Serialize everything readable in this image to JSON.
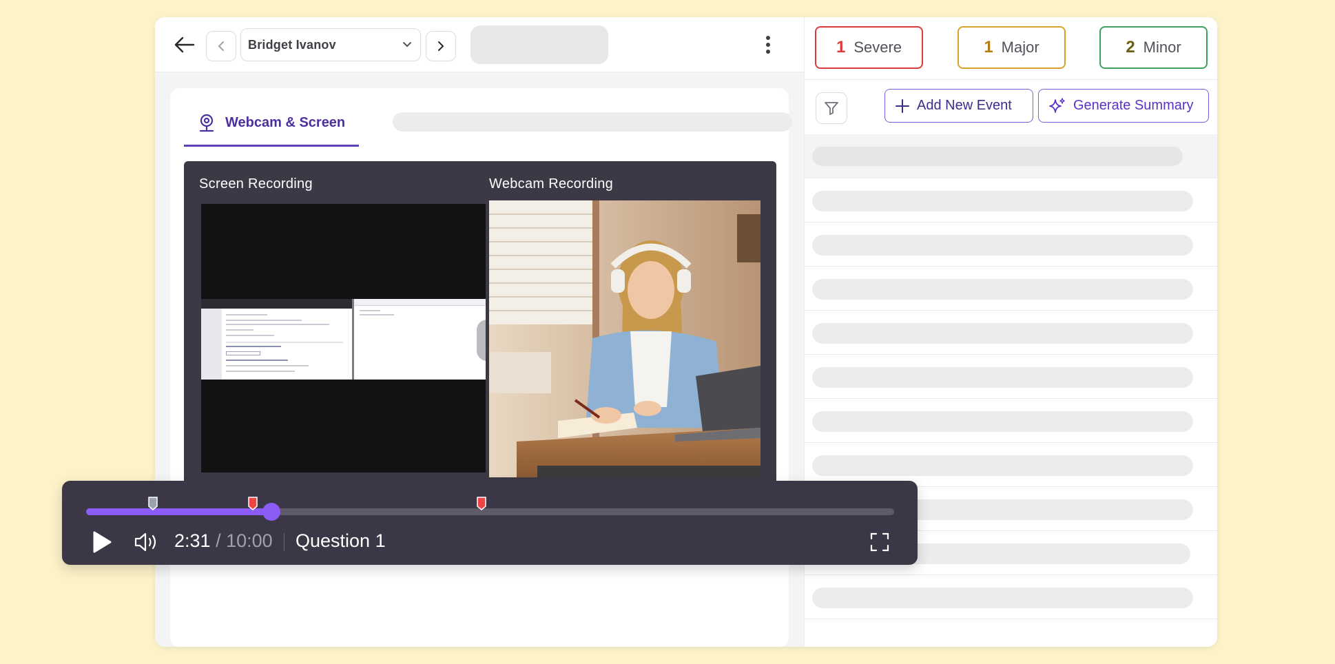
{
  "header": {
    "candidate_name": "Bridget  Ivanov",
    "back_icon": "arrow-left-icon",
    "prev_icon": "chevron-left-icon",
    "next_icon": "chevron-right-icon",
    "dropdown_icon": "chevron-down-icon",
    "menu_icon": "kebab-menu-icon"
  },
  "tabs": [
    {
      "label": "Webcam & Screen",
      "icon": "webcam-icon",
      "active": true
    }
  ],
  "player": {
    "screen_label": "Screen Recording",
    "webcam_label": "Webcam Recording",
    "current_time": "2:31",
    "separator": " / ",
    "duration": "10:00",
    "question": "Question 1",
    "progress_fraction": 0.229,
    "markers": [
      {
        "position_fraction": 0.083,
        "color": "#9ca3af"
      },
      {
        "position_fraction": 0.206,
        "color": "#ef4444"
      },
      {
        "position_fraction": 0.489,
        "color": "#ef4444"
      }
    ],
    "accent_color": "#8b5cf6"
  },
  "severity": {
    "severe": {
      "count": "1",
      "label": "Severe",
      "color": "#dc3b3b"
    },
    "major": {
      "count": "1",
      "label": "Major",
      "color": "#d6a326"
    },
    "minor": {
      "count": "2",
      "label": "Minor",
      "color": "#3fa05e"
    }
  },
  "actions": {
    "add_event_label": "Add New Event",
    "generate_summary_label": "Generate Summary",
    "filter_icon": "filter-icon",
    "add_icon": "plus-icon",
    "sparkle_icon": "sparkle-icon"
  }
}
